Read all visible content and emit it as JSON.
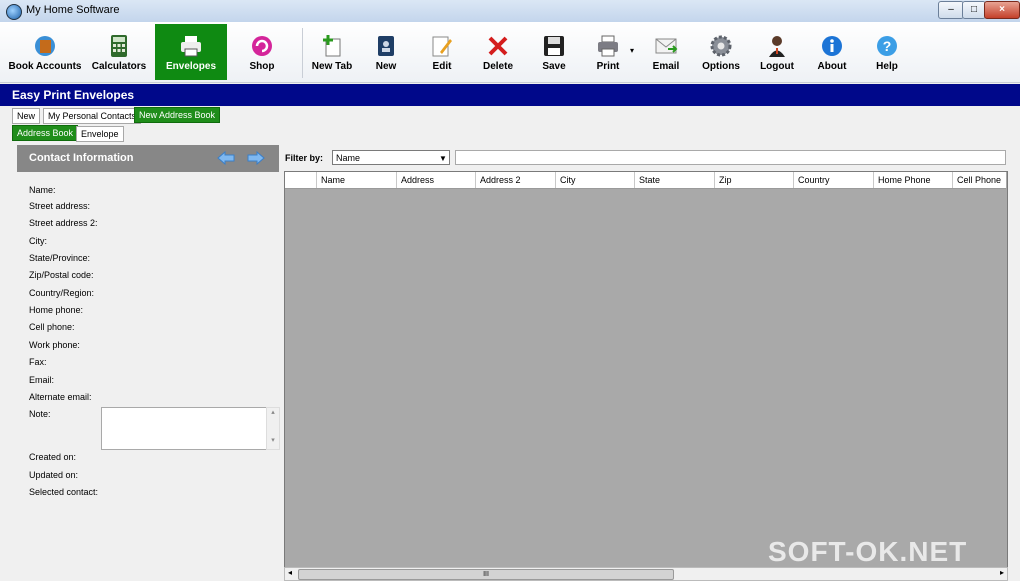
{
  "window": {
    "title": "My Home Software"
  },
  "toolbar": {
    "items": [
      {
        "label": "Book Accounts",
        "icon": "book-accounts-icon"
      },
      {
        "label": "Calculators",
        "icon": "calculator-icon"
      },
      {
        "label": "Envelopes",
        "icon": "printer-icon",
        "active": true
      },
      {
        "label": "Shop",
        "icon": "shop-icon"
      },
      {
        "label": "New Tab",
        "icon": "new-tab-icon"
      },
      {
        "label": "New",
        "icon": "new-icon"
      },
      {
        "label": "Edit",
        "icon": "edit-icon"
      },
      {
        "label": "Delete",
        "icon": "delete-icon"
      },
      {
        "label": "Save",
        "icon": "save-icon"
      },
      {
        "label": "Print",
        "icon": "print-icon"
      },
      {
        "label": "Email",
        "icon": "email-icon"
      },
      {
        "label": "Options",
        "icon": "gear-icon"
      },
      {
        "label": "Logout",
        "icon": "logout-icon"
      },
      {
        "label": "About",
        "icon": "info-icon"
      },
      {
        "label": "Help",
        "icon": "help-icon"
      }
    ]
  },
  "header": {
    "title": "Easy Print Envelopes"
  },
  "tabs": [
    {
      "label": "New"
    },
    {
      "label": "My Personal Contacts"
    },
    {
      "label": "New Address Book",
      "active": true
    }
  ],
  "subtabs": [
    {
      "label": "Address Book",
      "active": true
    },
    {
      "label": "Envelope"
    }
  ],
  "contact": {
    "title": "Contact Information",
    "fields": [
      "Name:",
      "Street address:",
      "Street address 2:",
      "City:",
      "State/Province:",
      "Zip/Postal code:",
      "Country/Region:",
      "Home phone:",
      "Cell phone:",
      "Work phone:",
      "Fax:",
      "Email:",
      "Alternate email:",
      "Note:",
      "Created on:",
      "Updated on:",
      "Selected contact:"
    ]
  },
  "filter": {
    "label": "Filter by:",
    "selected": "Name"
  },
  "grid": {
    "columns": [
      "Name",
      "Address",
      "Address 2",
      "City",
      "State",
      "Zip",
      "Country",
      "Home Phone",
      "Cell Phone"
    ]
  },
  "scrollbar": {
    "thumb": "III"
  },
  "watermark": "SOFT-OK.NET",
  "colors": {
    "accent_green": "#0f8a12",
    "header_blue": "#00088a",
    "grid_bg": "#a9a9a9"
  }
}
